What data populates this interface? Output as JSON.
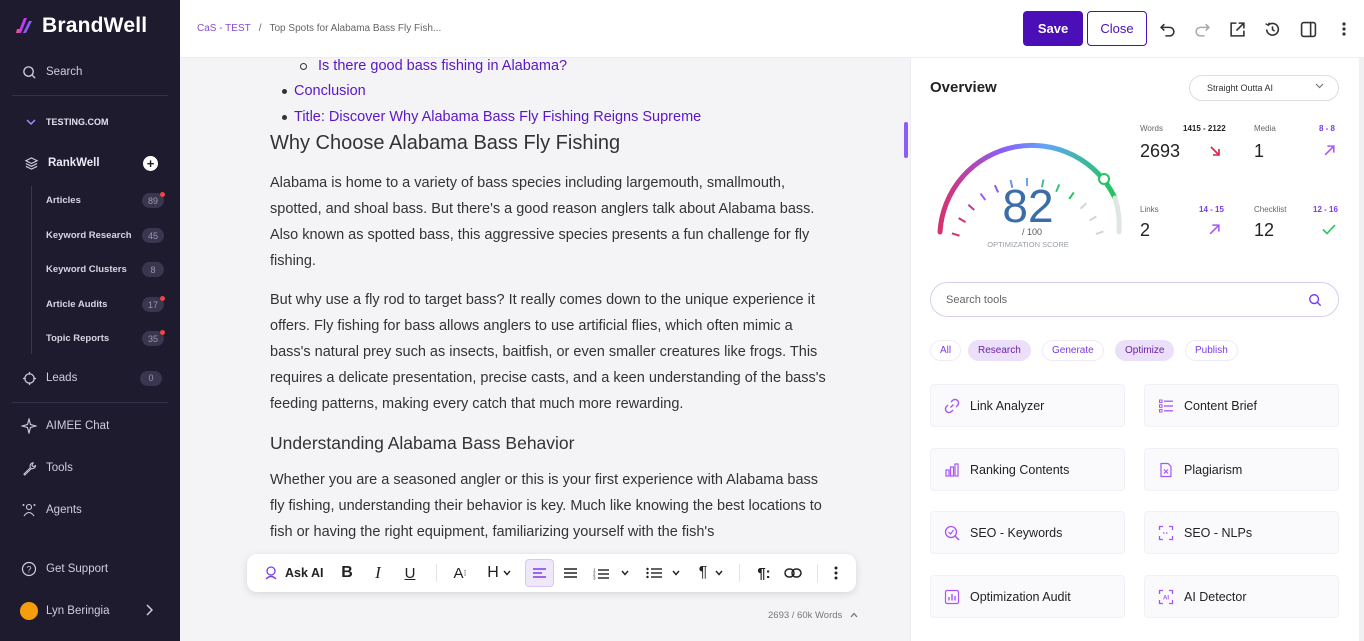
{
  "brand": {
    "name": "BrandWell"
  },
  "sidebar": {
    "search_label": "Search",
    "workspace": "TESTING.COM",
    "rankwell_label": "RankWell",
    "sub_items": [
      {
        "label": "Articles",
        "count": "89",
        "dot": true
      },
      {
        "label": "Keyword Research",
        "count": "45",
        "dot": false
      },
      {
        "label": "Keyword Clusters",
        "count": "8",
        "dot": false
      },
      {
        "label": "Article Audits",
        "count": "17",
        "dot": true
      },
      {
        "label": "Topic Reports",
        "count": "35",
        "dot": true
      }
    ],
    "leads_label": "Leads",
    "leads_count": "0",
    "aimee_label": "AIMEE Chat",
    "tools_label": "Tools",
    "agents_label": "Agents",
    "support_label": "Get Support",
    "user_name": "Lyn Beringia"
  },
  "topbar": {
    "breadcrumb_root": "CaS - TEST",
    "breadcrumb_sep": "/",
    "breadcrumb_current": "Top Spots for Alabama Bass Fly Fish...",
    "save_label": "Save",
    "close_label": "Close"
  },
  "document": {
    "sub_bullet": "Is there good bass fishing in Alabama?",
    "bullet_1": "Conclusion",
    "bullet_2": "Title: Discover Why Alabama Bass Fly Fishing Reigns Supreme",
    "h2_1": "Why Choose Alabama Bass Fly Fishing",
    "p1": "Alabama is home to a variety of bass species including largemouth, smallmouth, spotted, and shoal bass. But there's a good reason anglers talk about Alabama bass. Also known as spotted bass, this aggressive species presents a fun challenge for fly fishing.",
    "p2": "But why use a fly rod to target bass? It really comes down to the unique experience it offers. Fly fishing for bass allows anglers to use artificial flies, which often mimic a bass's natural prey such as insects, baitfish, or even smaller creatures like frogs. This requires a delicate presentation, precise casts, and a keen understanding of the bass's feeding patterns, making every catch that much more rewarding.",
    "h3_1": "Understanding Alabama Bass Behavior",
    "p3": "Whether you are a seasoned angler or this is your first experience with Alabama bass fly fishing, understanding their behavior is key. Much like knowing the best locations to fish or having the right equipment, familiarizing yourself with the fish's"
  },
  "toolbar": {
    "ask_ai_label": "Ask AI"
  },
  "word_count": "2693 / 60k Words",
  "overview": {
    "title": "Overview",
    "mode_select": "Straight Outta AI",
    "score": 82,
    "score_max_label": "/ 100",
    "score_caption": "OPTIMIZATION SCORE",
    "stats": {
      "words": {
        "label": "Words",
        "range": "1415 - 2122",
        "value": "2693",
        "trend": "down"
      },
      "media": {
        "label": "Media",
        "range": "8 - 8",
        "value": "1",
        "trend": "up"
      },
      "links": {
        "label": "Links",
        "range": "14 - 15",
        "value": "2",
        "trend": "up"
      },
      "checklist": {
        "label": "Checklist",
        "range": "12 - 16",
        "value": "12",
        "trend": "check"
      }
    },
    "search_placeholder": "Search tools",
    "filters": [
      {
        "label": "All",
        "active": false
      },
      {
        "label": "Research",
        "active": true
      },
      {
        "label": "Generate",
        "active": false
      },
      {
        "label": "Optimize",
        "active": true
      },
      {
        "label": "Publish",
        "active": false
      }
    ],
    "tools": [
      {
        "label": "Link Analyzer",
        "icon": "link-icon"
      },
      {
        "label": "Content Brief",
        "icon": "list-icon"
      },
      {
        "label": "Ranking Contents",
        "icon": "bar-chart-icon"
      },
      {
        "label": "Plagiarism",
        "icon": "document-x-icon"
      },
      {
        "label": "SEO - Keywords",
        "icon": "search-keyword-icon"
      },
      {
        "label": "SEO - NLPs",
        "icon": "scan-icon"
      },
      {
        "label": "Optimization Audit",
        "icon": "audit-chart-icon"
      },
      {
        "label": "AI Detector",
        "icon": "ai-scan-icon"
      }
    ]
  },
  "colors": {
    "accent": "#4b0fb7",
    "sidebar_bg": "#1e1b2e",
    "link": "#5b16c8"
  }
}
